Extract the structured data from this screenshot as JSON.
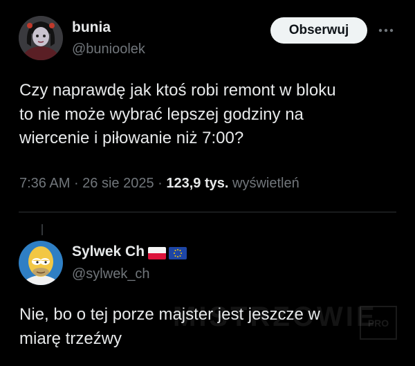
{
  "tweet": {
    "author_name": "bunia",
    "author_handle": "@bunioolek",
    "follow_label": "Obserwuj",
    "text_lines": [
      "Czy naprawdę jak ktoś robi remont w bloku",
      "to nie może wybrać lepszej godziny na",
      "wiercenie i piłowanie niż 7:00?"
    ],
    "time": "7:36 AM",
    "date": "26 sie 2025",
    "views_count": "123,9 tys.",
    "views_label": "wyświetleń"
  },
  "reply": {
    "author_name": "Sylwek Ch",
    "author_handle": "@sylwek_ch",
    "text_lines": [
      "Nie, bo o tej porze majster jest jeszcze w",
      "miarę trzeźwy"
    ]
  },
  "watermark": {
    "text": "MISTRZOWIE",
    "badge": "PRO"
  },
  "icons": {
    "more": "more-horizontal-icon",
    "flag_pl": "poland-flag-icon",
    "flag_eu": "eu-flag-icon"
  },
  "colors": {
    "background": "#000000",
    "text": "#e7e9ea",
    "secondary_text": "#71767b",
    "button_bg": "#eff3f4",
    "button_text": "#0f1419"
  }
}
